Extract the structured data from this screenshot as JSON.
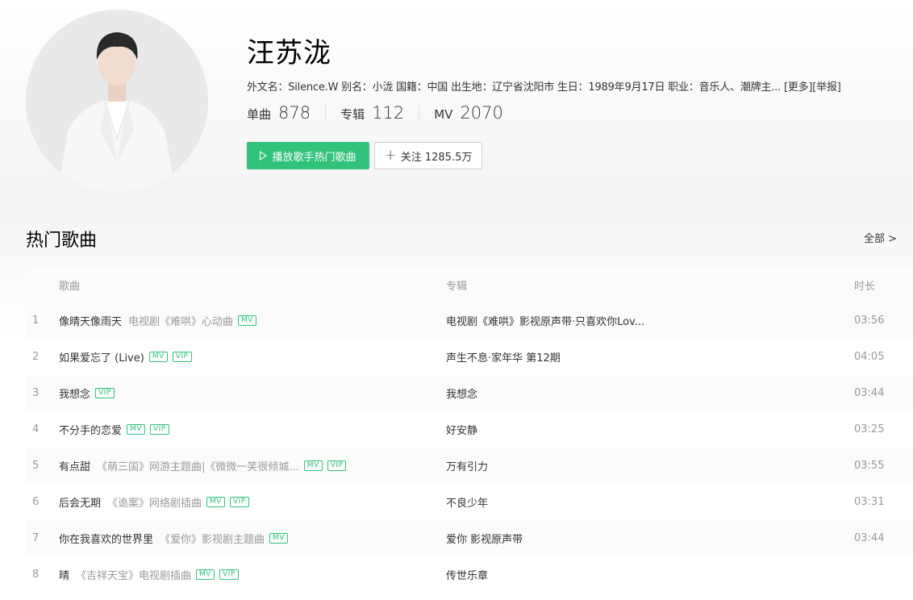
{
  "artist": {
    "name": "汪苏泷",
    "info": "外文名：Silence.W 别名：小泷 国籍：中国 出生地：辽宁省沈阳市 生日：1989年9月17日 职业：音乐人、潮牌主...",
    "more_label": "[更多]",
    "report_label": "[举报]",
    "stats": [
      {
        "label": "单曲",
        "value": "878"
      },
      {
        "label": "专辑",
        "value": "112"
      },
      {
        "label": "MV",
        "value": "2070"
      }
    ],
    "play_button": "播放歌手热门歌曲",
    "follow_button": "关注 1285.5万"
  },
  "section": {
    "title": "热门歌曲",
    "view_all": "全部 >"
  },
  "table": {
    "headers": {
      "song": "歌曲",
      "album": "专辑",
      "duration": "时长"
    },
    "rows": [
      {
        "idx": "1",
        "name": "像晴天像雨天",
        "desc": "电视剧《难哄》心动曲",
        "tags": [
          "MV"
        ],
        "album": "电视剧《难哄》影视原声带·只喜欢你Lov...",
        "duration": "03:56"
      },
      {
        "idx": "2",
        "name": "如果爱忘了 (Live)",
        "desc": "",
        "tags": [
          "MV",
          "VIP"
        ],
        "album": "声生不息·家年华 第12期",
        "duration": "04:05"
      },
      {
        "idx": "3",
        "name": "我想念",
        "desc": "",
        "tags": [
          "VIP"
        ],
        "album": "我想念",
        "duration": "03:44"
      },
      {
        "idx": "4",
        "name": "不分手的恋爱",
        "desc": "",
        "tags": [
          "MV",
          "VIP"
        ],
        "album": "好安静",
        "duration": "03:25"
      },
      {
        "idx": "5",
        "name": "有点甜",
        "desc": "《萌三国》网游主题曲|《微微一笑很倾城...",
        "tags": [
          "MV",
          "VIP"
        ],
        "album": "万有引力",
        "duration": "03:55"
      },
      {
        "idx": "6",
        "name": "后会无期",
        "desc": "《诡案》网络剧插曲",
        "tags": [
          "MV",
          "VIP"
        ],
        "album": "不良少年",
        "duration": "03:31"
      },
      {
        "idx": "7",
        "name": "你在我喜欢的世界里",
        "desc": "《爱你》影视剧主题曲",
        "tags": [
          "MV"
        ],
        "album": "爱你 影视原声带",
        "duration": "03:44"
      },
      {
        "idx": "8",
        "name": "晴",
        "desc": "《吉祥天宝》电视剧插曲",
        "tags": [
          "MV",
          "VIP"
        ],
        "album": "传世乐章",
        "duration": ""
      }
    ]
  },
  "colors": {
    "accent": "#31c27c",
    "muted": "#999999"
  }
}
